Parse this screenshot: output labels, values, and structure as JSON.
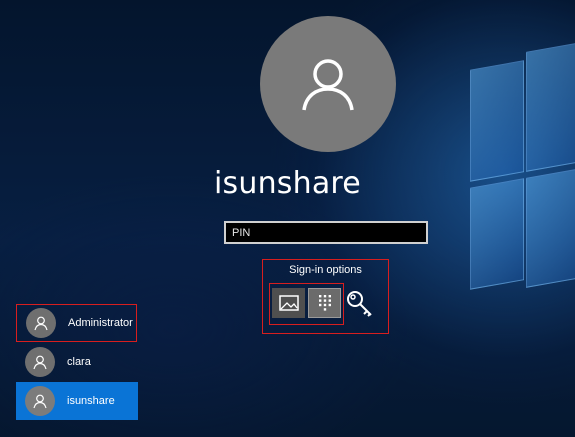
{
  "colors": {
    "accent": "#0a74d6",
    "highlight_border": "#d81e1e",
    "avatar_gray": "#7a7a7a"
  },
  "login": {
    "avatar_icon": "user-silhouette-icon",
    "username": "isunshare",
    "pin_placeholder": "PIN",
    "pin_value": ""
  },
  "signin_options": {
    "label": "Sign-in options",
    "options": [
      {
        "name": "picture-password",
        "icon": "picture-icon"
      },
      {
        "name": "pin",
        "icon": "keypad-icon",
        "selected": true
      },
      {
        "name": "password",
        "icon": "key-icon"
      }
    ]
  },
  "user_list": [
    {
      "name": "Administrator",
      "icon": "user-silhouette-icon",
      "selected": false
    },
    {
      "name": "clara",
      "icon": "user-silhouette-icon",
      "selected": false
    },
    {
      "name": "isunshare",
      "icon": "user-silhouette-icon",
      "selected": true
    }
  ]
}
